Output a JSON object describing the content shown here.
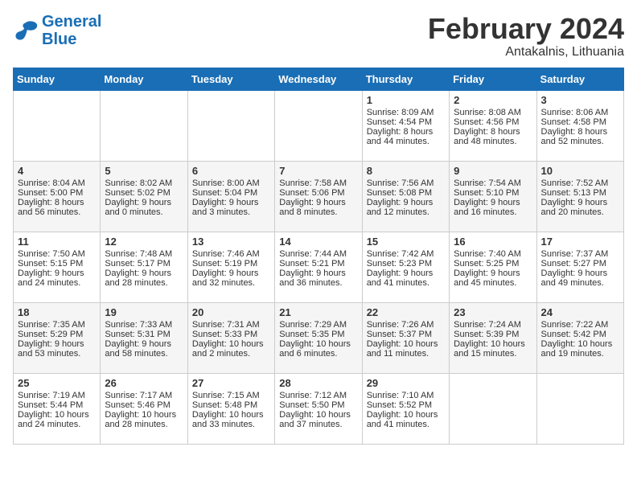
{
  "header": {
    "logo_general": "General",
    "logo_blue": "Blue",
    "month_title": "February 2024",
    "location": "Antakalnis, Lithuania"
  },
  "weekdays": [
    "Sunday",
    "Monday",
    "Tuesday",
    "Wednesday",
    "Thursday",
    "Friday",
    "Saturday"
  ],
  "weeks": [
    [
      {
        "day": "",
        "content": ""
      },
      {
        "day": "",
        "content": ""
      },
      {
        "day": "",
        "content": ""
      },
      {
        "day": "",
        "content": ""
      },
      {
        "day": "1",
        "content": "Sunrise: 8:09 AM\nSunset: 4:54 PM\nDaylight: 8 hours\nand 44 minutes."
      },
      {
        "day": "2",
        "content": "Sunrise: 8:08 AM\nSunset: 4:56 PM\nDaylight: 8 hours\nand 48 minutes."
      },
      {
        "day": "3",
        "content": "Sunrise: 8:06 AM\nSunset: 4:58 PM\nDaylight: 8 hours\nand 52 minutes."
      }
    ],
    [
      {
        "day": "4",
        "content": "Sunrise: 8:04 AM\nSunset: 5:00 PM\nDaylight: 8 hours\nand 56 minutes."
      },
      {
        "day": "5",
        "content": "Sunrise: 8:02 AM\nSunset: 5:02 PM\nDaylight: 9 hours\nand 0 minutes."
      },
      {
        "day": "6",
        "content": "Sunrise: 8:00 AM\nSunset: 5:04 PM\nDaylight: 9 hours\nand 3 minutes."
      },
      {
        "day": "7",
        "content": "Sunrise: 7:58 AM\nSunset: 5:06 PM\nDaylight: 9 hours\nand 8 minutes."
      },
      {
        "day": "8",
        "content": "Sunrise: 7:56 AM\nSunset: 5:08 PM\nDaylight: 9 hours\nand 12 minutes."
      },
      {
        "day": "9",
        "content": "Sunrise: 7:54 AM\nSunset: 5:10 PM\nDaylight: 9 hours\nand 16 minutes."
      },
      {
        "day": "10",
        "content": "Sunrise: 7:52 AM\nSunset: 5:13 PM\nDaylight: 9 hours\nand 20 minutes."
      }
    ],
    [
      {
        "day": "11",
        "content": "Sunrise: 7:50 AM\nSunset: 5:15 PM\nDaylight: 9 hours\nand 24 minutes."
      },
      {
        "day": "12",
        "content": "Sunrise: 7:48 AM\nSunset: 5:17 PM\nDaylight: 9 hours\nand 28 minutes."
      },
      {
        "day": "13",
        "content": "Sunrise: 7:46 AM\nSunset: 5:19 PM\nDaylight: 9 hours\nand 32 minutes."
      },
      {
        "day": "14",
        "content": "Sunrise: 7:44 AM\nSunset: 5:21 PM\nDaylight: 9 hours\nand 36 minutes."
      },
      {
        "day": "15",
        "content": "Sunrise: 7:42 AM\nSunset: 5:23 PM\nDaylight: 9 hours\nand 41 minutes."
      },
      {
        "day": "16",
        "content": "Sunrise: 7:40 AM\nSunset: 5:25 PM\nDaylight: 9 hours\nand 45 minutes."
      },
      {
        "day": "17",
        "content": "Sunrise: 7:37 AM\nSunset: 5:27 PM\nDaylight: 9 hours\nand 49 minutes."
      }
    ],
    [
      {
        "day": "18",
        "content": "Sunrise: 7:35 AM\nSunset: 5:29 PM\nDaylight: 9 hours\nand 53 minutes."
      },
      {
        "day": "19",
        "content": "Sunrise: 7:33 AM\nSunset: 5:31 PM\nDaylight: 9 hours\nand 58 minutes."
      },
      {
        "day": "20",
        "content": "Sunrise: 7:31 AM\nSunset: 5:33 PM\nDaylight: 10 hours\nand 2 minutes."
      },
      {
        "day": "21",
        "content": "Sunrise: 7:29 AM\nSunset: 5:35 PM\nDaylight: 10 hours\nand 6 minutes."
      },
      {
        "day": "22",
        "content": "Sunrise: 7:26 AM\nSunset: 5:37 PM\nDaylight: 10 hours\nand 11 minutes."
      },
      {
        "day": "23",
        "content": "Sunrise: 7:24 AM\nSunset: 5:39 PM\nDaylight: 10 hours\nand 15 minutes."
      },
      {
        "day": "24",
        "content": "Sunrise: 7:22 AM\nSunset: 5:42 PM\nDaylight: 10 hours\nand 19 minutes."
      }
    ],
    [
      {
        "day": "25",
        "content": "Sunrise: 7:19 AM\nSunset: 5:44 PM\nDaylight: 10 hours\nand 24 minutes."
      },
      {
        "day": "26",
        "content": "Sunrise: 7:17 AM\nSunset: 5:46 PM\nDaylight: 10 hours\nand 28 minutes."
      },
      {
        "day": "27",
        "content": "Sunrise: 7:15 AM\nSunset: 5:48 PM\nDaylight: 10 hours\nand 33 minutes."
      },
      {
        "day": "28",
        "content": "Sunrise: 7:12 AM\nSunset: 5:50 PM\nDaylight: 10 hours\nand 37 minutes."
      },
      {
        "day": "29",
        "content": "Sunrise: 7:10 AM\nSunset: 5:52 PM\nDaylight: 10 hours\nand 41 minutes."
      },
      {
        "day": "",
        "content": ""
      },
      {
        "day": "",
        "content": ""
      }
    ]
  ]
}
